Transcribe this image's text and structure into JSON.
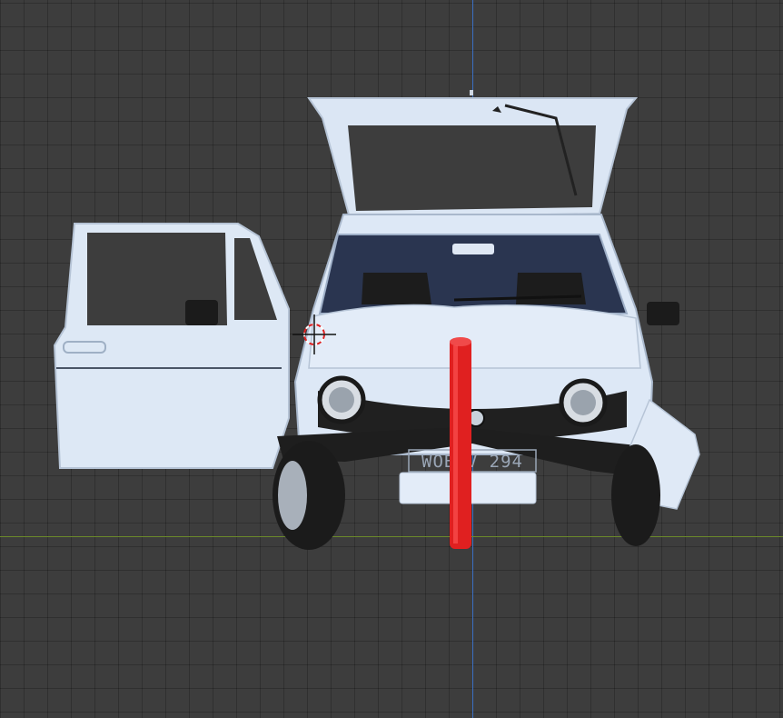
{
  "viewport": {
    "background": "#3d3d3d",
    "grid_color": "#333333",
    "axis_x_color": "#6b8a2a",
    "axis_y_color": "#3b6fc2",
    "grid": true
  },
  "scene": {
    "object": "car-model",
    "body_color": "#dce8f6",
    "pole_color": "#e02020",
    "license_plate": "WOB-V 294",
    "cursor_icon": "3d-cursor-icon"
  }
}
